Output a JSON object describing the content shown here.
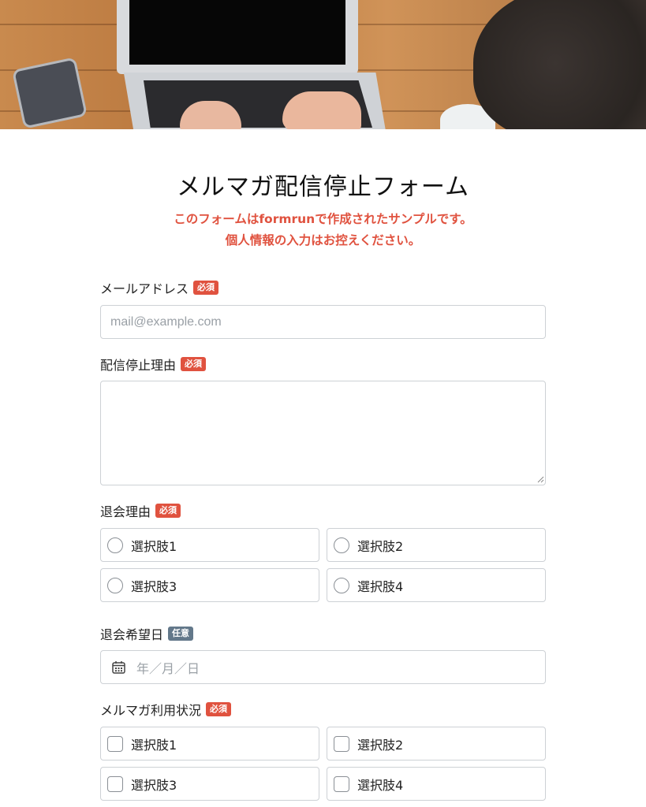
{
  "form": {
    "title": "メルマガ配信停止フォーム",
    "notice_line1": "このフォームはformrunで作成されたサンプルです。",
    "notice_line2": "個人情報の入力はお控えください。"
  },
  "badges": {
    "required": "必須",
    "optional": "任意"
  },
  "fields": {
    "email": {
      "label": "メールアドレス",
      "placeholder": "mail@example.com",
      "value": ""
    },
    "reason": {
      "label": "配信停止理由",
      "value": ""
    },
    "withdraw_reason": {
      "label": "退会理由",
      "type": "radio",
      "options": [
        "選択肢1",
        "選択肢2",
        "選択肢3",
        "選択肢4"
      ]
    },
    "withdraw_date": {
      "label": "退会希望日",
      "placeholder": "年／月／日",
      "icon": "calendar-icon"
    },
    "newsletter_usage": {
      "label": "メルマガ利用状況",
      "type": "checkbox",
      "options": [
        "選択肢1",
        "選択肢2",
        "選択肢3",
        "選択肢4"
      ]
    }
  },
  "colors": {
    "accent_red": "#e0523f",
    "optional_badge": "#63788a",
    "border": "#cdd1d5"
  }
}
